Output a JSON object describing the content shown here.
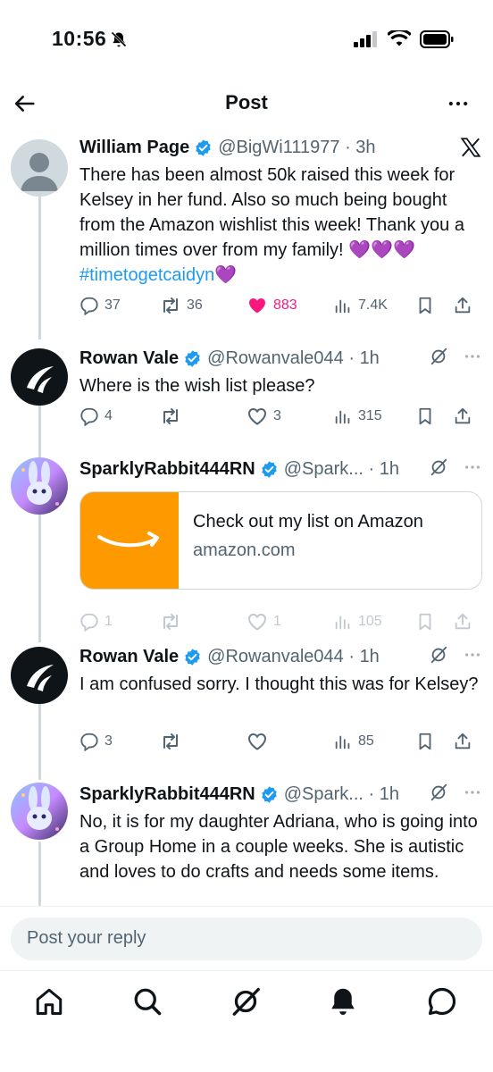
{
  "status_bar": {
    "time": "10:56"
  },
  "header": {
    "title": "Post"
  },
  "tweets": [
    {
      "name": "William Page",
      "handle": "@BigWi111977",
      "time": "3h",
      "text_main": "There has been almost 50k raised this week for Kelsey in her fund. Also so much being bought from the Amazon wishlist this week! Thank you a million times over from my family! 💜💜💜 ",
      "hashtag": "#timetogetcaidyn",
      "text_end": "💜",
      "replies": "37",
      "reposts": "36",
      "likes": "883",
      "views": "7.4K"
    },
    {
      "name": "Rowan Vale",
      "handle": "@Rowanvale044",
      "time": "1h",
      "text": "Where is the wish list please?",
      "replies": "4",
      "reposts": "",
      "likes": "3",
      "views": "315"
    },
    {
      "name": "SparklyRabbit444RN",
      "handle": "@Spark...",
      "time": "1h",
      "link_title": "Check out my list on Amazon",
      "link_domain": "amazon.com",
      "replies": "1",
      "reposts": "",
      "likes": "1",
      "views": "105"
    },
    {
      "name": "Rowan Vale",
      "handle": "@Rowanvale044",
      "time": "1h",
      "text": "I am confused sorry. I thought this was for Kelsey?",
      "replies": "3",
      "reposts": "",
      "likes": "",
      "views": "85"
    },
    {
      "name": "SparklyRabbit444RN",
      "handle": "@Spark...",
      "time": "1h",
      "text": "No, it is for my daughter Adriana, who is going into a Group Home in a couple weeks. She is autistic and loves to do crafts and needs some items."
    }
  ],
  "reply": {
    "placeholder": "Post your reply"
  },
  "icons": {
    "back": "arrow-left-icon",
    "more": "more-icon",
    "x_logo": "x-logo-icon",
    "verified": "verified-badge-icon",
    "grok": "grok-icon",
    "reply": "reply-icon",
    "repost": "repost-icon",
    "like": "heart-icon",
    "views": "views-icon",
    "bookmark": "bookmark-icon",
    "share": "share-icon",
    "home": "home-icon",
    "search": "search-icon",
    "notifications": "bell-icon",
    "messages": "messages-icon"
  },
  "colors": {
    "accent": "#1d9bf0",
    "like": "#f91880",
    "amazon": "#ff9900",
    "muted": "#536471"
  }
}
